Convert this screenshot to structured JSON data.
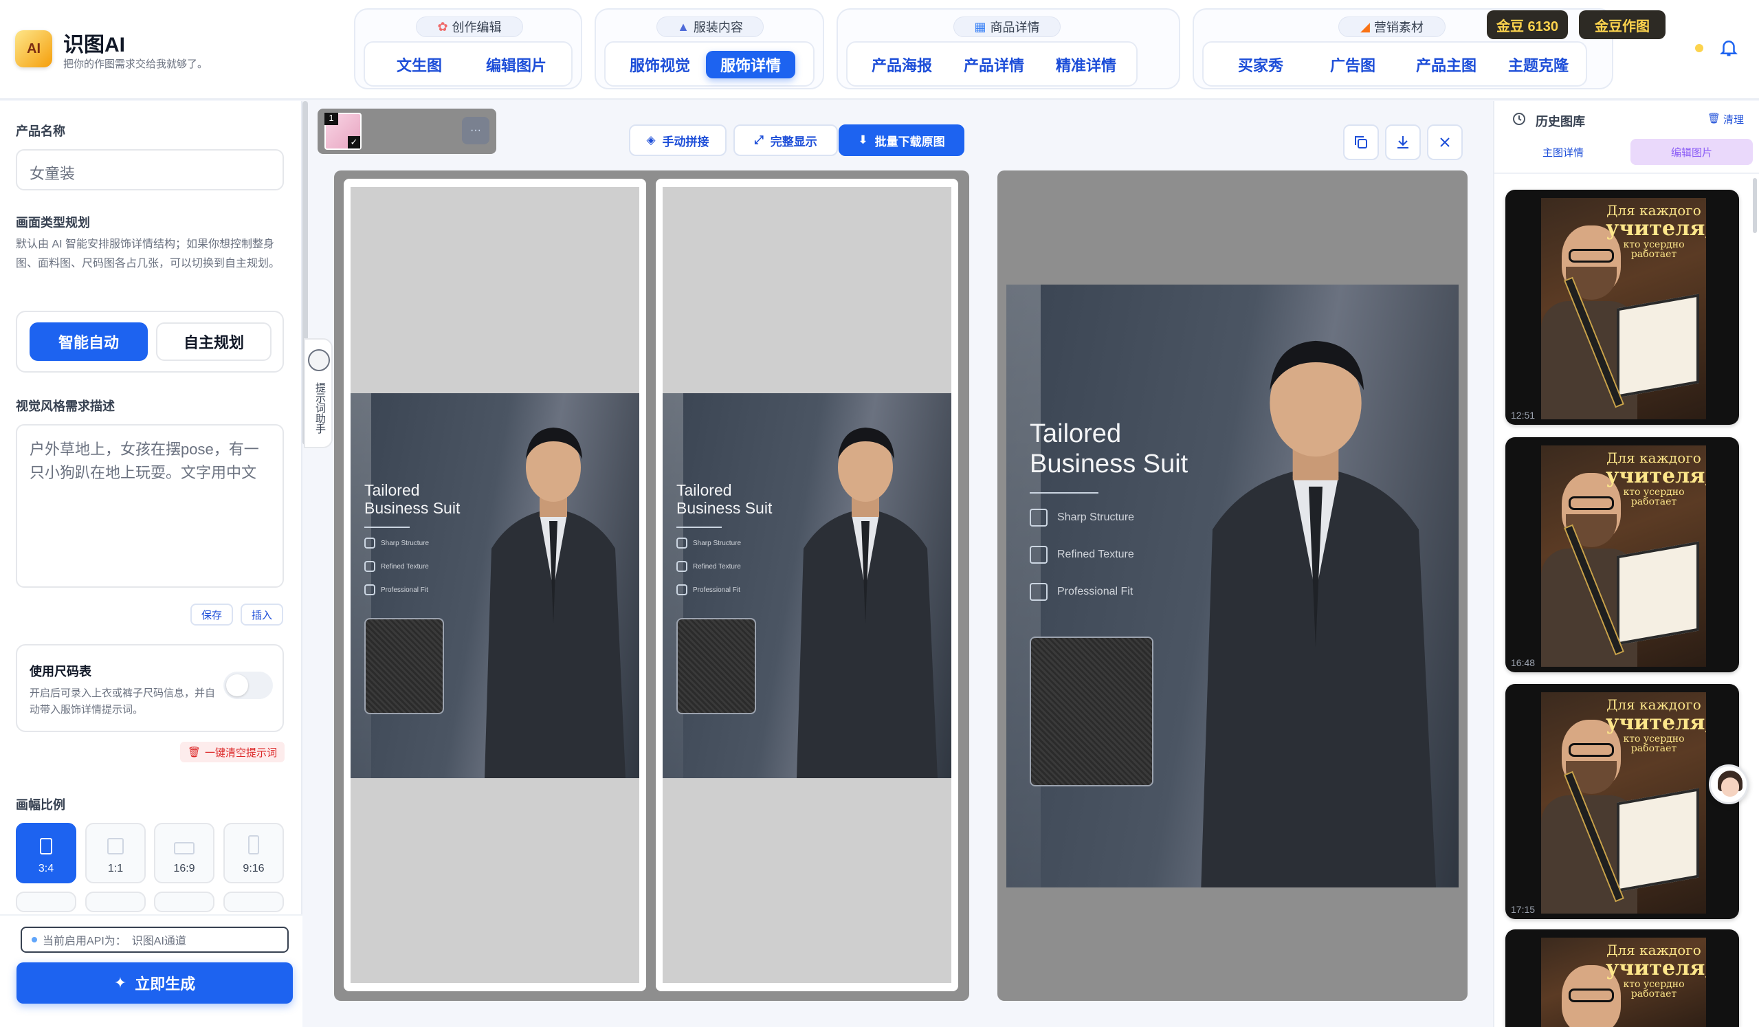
{
  "app": {
    "name": "识图AI",
    "slogan": "把你的作图需求交给我就够了。",
    "logo_text": "AI"
  },
  "nav_groups": [
    {
      "title": "创作编辑",
      "items": [
        "文生图",
        "编辑图片"
      ]
    },
    {
      "title": "服装内容",
      "items": [
        "服饰视觉",
        "服饰详情"
      ],
      "active": "服饰详情"
    },
    {
      "title": "商品详情",
      "items": [
        "产品海报",
        "产品详情",
        "精准详情"
      ]
    },
    {
      "title": "营销素材",
      "items": [
        "买家秀",
        "广告图",
        "产品主图",
        "主题克隆"
      ]
    }
  ],
  "header_buttons": {
    "coins": "金豆 6130",
    "coin_draw": "金豆作图"
  },
  "left_panel": {
    "product_name_label": "产品名称",
    "product_name_value": "女童装",
    "layout_label": "画面类型规划",
    "layout_desc": "默认由 AI 智能安排服饰详情结构；如果你想控制整身图、面料图、尺码图各占几张，可以切换到自主规划。",
    "mode_auto": "智能自动",
    "mode_manual": "自主规划",
    "style_label": "视觉风格需求描述",
    "style_value": "户外草地上，女孩在摆pose，有一只小狗趴在地上玩耍。文字用中文",
    "save_btn": "保存",
    "insert_btn": "插入",
    "size_chart_title": "使用尺码表",
    "size_chart_desc": "开启后可录入上衣或裤子尺码信息，并自动带入服饰详情提示词。",
    "size_chart_enabled": false,
    "clear_prompt_btn": "一键清空提示词",
    "ratio_label": "画幅比例",
    "ratios": [
      "3:4",
      "1:1",
      "16:9",
      "9:16"
    ],
    "ratio_selected": "3:4",
    "api_label": "当前启用API为：",
    "api_value": "识图AI通道",
    "generate_btn": "立即生成"
  },
  "side_tab": {
    "label": "提示词助手"
  },
  "thumb_strip": {
    "count_badge": "1",
    "more": "···"
  },
  "toolbar": {
    "manual_stitch": "手动拼接",
    "full_display": "完整显示",
    "batch_download": "批量下载原图"
  },
  "poster": {
    "title_line1": "Tailored",
    "title_line2": "Business Suit",
    "features": [
      "Sharp Structure",
      "Refined Texture",
      "Professional Fit"
    ]
  },
  "history": {
    "title": "历史图库",
    "clear": "清理",
    "tab_main": "主图详情",
    "tab_edit": "编辑图片",
    "items": [
      {
        "time": "12:51"
      },
      {
        "time": "16:48"
      },
      {
        "time": "17:15"
      },
      {
        "time": ""
      }
    ],
    "overlay_text": [
      "Для каждого",
      "учителя,",
      "кто усердно",
      "работает"
    ]
  },
  "colors": {
    "accent": "#1d63f0",
    "coin_bg": "#2d2a24",
    "coin_text": "#fcd34d",
    "danger": "#dc2626"
  }
}
